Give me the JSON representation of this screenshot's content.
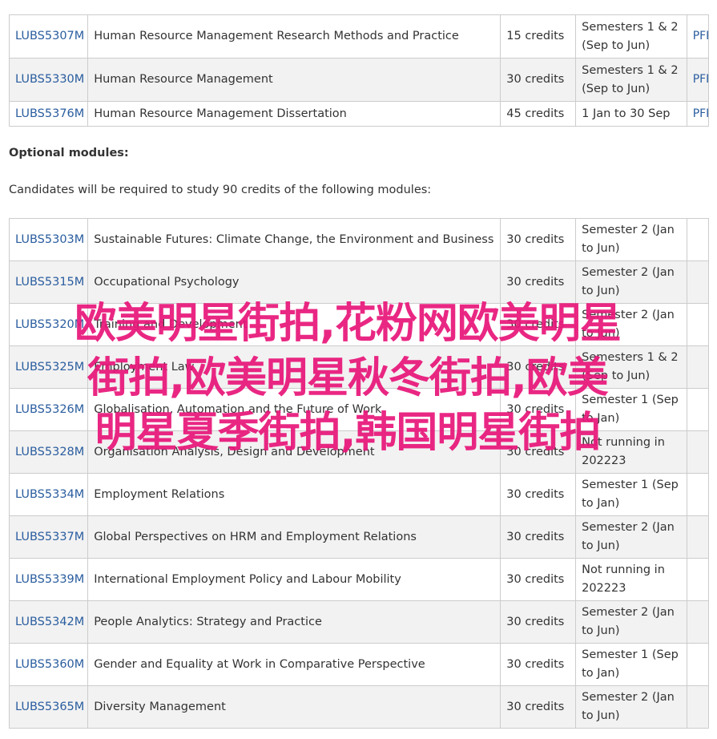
{
  "core_modules": [
    {
      "code": "LUBS5307M",
      "title": "Human Resource Management Research Methods and Practice",
      "credits": "15 credits",
      "semester": "Semesters 1 & 2 (Sep to Jun)",
      "spec": "PFP"
    },
    {
      "code": "LUBS5330M",
      "title": "Human Resource Management",
      "credits": "30 credits",
      "semester": "Semesters 1 & 2 (Sep to Jun)",
      "spec": "PFP"
    },
    {
      "code": "LUBS5376M",
      "title": "Human Resource Management Dissertation",
      "credits": "45 credits",
      "semester": "1 Jan to 30 Sep",
      "spec": "PFP"
    }
  ],
  "optional": {
    "heading": "Optional modules:",
    "intro": "Candidates will be required to study 90 credits of the following modules:"
  },
  "optional_modules": [
    {
      "code": "LUBS5303M",
      "title": "Sustainable Futures: Climate Change, the Environment and Business",
      "credits": "30 credits",
      "semester": "Semester 2 (Jan to Jun)"
    },
    {
      "code": "LUBS5315M",
      "title": "Occupational Psychology",
      "credits": "30 credits",
      "semester": "Semester 2 (Jan to Jun)"
    },
    {
      "code": "LUBS5320M",
      "title": "Training and Development",
      "credits": "30 credits",
      "semester": "Semester 2 (Jan to Jun)"
    },
    {
      "code": "LUBS5325M",
      "title": "Employment Law",
      "credits": "30 credits",
      "semester": "Semesters 1 & 2 (Sep to Jun)"
    },
    {
      "code": "LUBS5326M",
      "title": "Globalisation, Automation and the Future of Work",
      "credits": "30 credits",
      "semester": "Semester 1 (Sep to Jan)"
    },
    {
      "code": "LUBS5328M",
      "title": "Organisation Analysis, Design and Development",
      "credits": "30 credits",
      "semester": "Not running in 202223"
    },
    {
      "code": "LUBS5334M",
      "title": "Employment Relations",
      "credits": "30 credits",
      "semester": "Semester 1 (Sep to Jan)"
    },
    {
      "code": "LUBS5337M",
      "title": "Global Perspectives on HRM and Employment Relations",
      "credits": "30 credits",
      "semester": "Semester 2 (Jan to Jun)"
    },
    {
      "code": "LUBS5339M",
      "title": "International Employment Policy and Labour Mobility",
      "credits": "30 credits",
      "semester": "Not running in 202223"
    },
    {
      "code": "LUBS5342M",
      "title": "People Analytics: Strategy and Practice",
      "credits": "30 credits",
      "semester": "Semester 2 (Jan to Jun)"
    },
    {
      "code": "LUBS5360M",
      "title": "Gender and Equality at Work in Comparative Perspective",
      "credits": "30 credits",
      "semester": "Semester 1 (Sep to Jan)"
    },
    {
      "code": "LUBS5365M",
      "title": "Diversity Management",
      "credits": "30 credits",
      "semester": "Semester 2 (Jan to Jun)"
    }
  ],
  "watermark": {
    "line1": "欧美明星街拍,花粉网欧美明星",
    "line2": "街拍,欧美明星秋冬街拍,欧美",
    "line3": "明星夏季街拍,韩国明星街拍"
  },
  "colors": {
    "link": "#2a5d9f",
    "border": "#cccccc",
    "row_alt": "#f2f2f2",
    "watermark": "#e8177a"
  }
}
